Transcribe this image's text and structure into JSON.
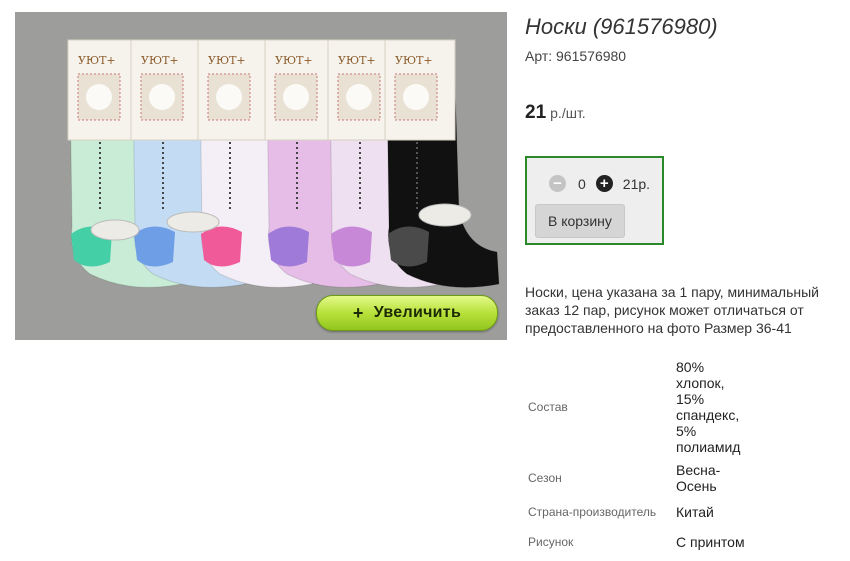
{
  "product": {
    "title": "Носки (961576980)",
    "article": "Арт: 961576980",
    "price_value": "21",
    "price_unit": "р./шт.",
    "description": "Носки, цена указана за 1 пару, минимальный заказ 12 пар, рисунок может отличаться от предоставленного на фото Размер 36-41"
  },
  "image": {
    "zoom_label": "Увеличить",
    "zoom_icon": "plus-icon",
    "package_brand": "УЮТ+",
    "sock_colors": [
      "#c9ecd6",
      "#c3dcf4",
      "#f4eef6",
      "#e6bde6",
      "#eee0f0",
      "#111111"
    ],
    "heel_colors": [
      "#44cfa6",
      "#6e9ee6",
      "#f05a98",
      "#a07ad8",
      "#c888d8",
      "#4a4a4a"
    ]
  },
  "buy_box": {
    "minus_icon": "minus-circle-icon",
    "plus_icon": "plus-circle-icon",
    "quantity": "0",
    "sum": "21р.",
    "cart_label": "В корзину",
    "border_color": "#2a8a2a"
  },
  "properties": [
    {
      "label": "Состав",
      "value": "80% хлопок, 15% спандекс, 5% полиамид"
    },
    {
      "label": "Сезон",
      "value": "Весна-Осень"
    },
    {
      "label": "Страна-производитель",
      "value": "Китай"
    },
    {
      "label": "Рисунок",
      "value": "С принтом"
    }
  ]
}
